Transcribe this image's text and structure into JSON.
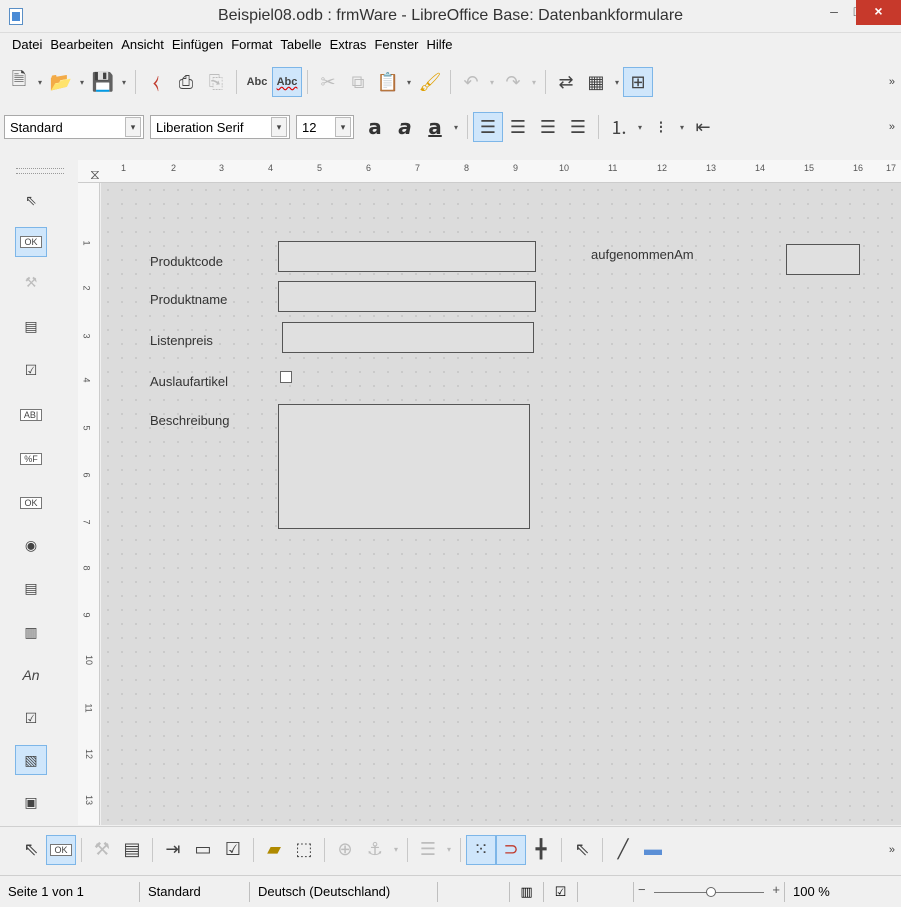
{
  "window": {
    "title": "Beispiel08.odb : frmWare - LibreOffice Base: Datenbankformulare",
    "minimize": "–",
    "maximize": "□",
    "close": "×"
  },
  "menu": [
    {
      "label": "Datei"
    },
    {
      "label": "Bearbeiten"
    },
    {
      "label": "Ansicht"
    },
    {
      "label": "Einfügen"
    },
    {
      "label": "Format"
    },
    {
      "label": "Tabelle"
    },
    {
      "label": "Extras"
    },
    {
      "label": "Fenster"
    },
    {
      "label": "Hilfe"
    }
  ],
  "toolbar1": {
    "icons": [
      "new-document-icon",
      "open-folder-icon",
      "save-icon",
      "export-pdf-icon",
      "print-icon",
      "print-preview-icon",
      "spellcheck-icon",
      "autospellcheck-icon",
      "cut-icon",
      "copy-icon",
      "paste-icon",
      "clone-formatting-icon",
      "undo-icon",
      "redo-icon",
      "find-replace-icon",
      "table-icon",
      "design-mode-icon"
    ],
    "spell_label": "Abc",
    "more": "»"
  },
  "format_toolbar": {
    "paragraph_style": "Standard",
    "font_name": "Liberation Serif",
    "font_size": "12",
    "bold_glyph": "a",
    "italic_glyph": "a",
    "underline_glyph": "a",
    "more": "»"
  },
  "ruler": {
    "numbers": [
      "1",
      "2",
      "3",
      "4",
      "5",
      "6",
      "7",
      "8",
      "9",
      "10",
      "11",
      "12",
      "13",
      "14",
      "15",
      "16",
      "17"
    ],
    "vnumbers": [
      "1",
      "2",
      "3",
      "4",
      "5",
      "6",
      "7",
      "8",
      "9",
      "10",
      "11",
      "12",
      "13"
    ]
  },
  "left_toolbar": {
    "icons": [
      "select-icon",
      "design-mode-icon",
      "control-properties-icon",
      "form-properties-icon",
      "checkbox-icon",
      "textbox-icon",
      "formatted-field-icon",
      "push-button-icon",
      "option-button-icon",
      "list-box-icon",
      "combo-box-icon",
      "label-field-icon",
      "more-controls-icon",
      "form-design-icon",
      "form-navigator-icon"
    ],
    "textbox_label": "AB|",
    "formatted_label": "%F",
    "ok_label": "OK",
    "label_text": "An"
  },
  "form": {
    "labels": {
      "produktcode": "Produktcode",
      "produktname": "Produktname",
      "listenpreis": "Listenpreis",
      "auslaufartikel": "Auslaufartikel",
      "beschreibung": "Beschreibung",
      "aufgenommenam": "aufgenommenAm"
    }
  },
  "bottom_toolbar": {
    "icons": [
      "select-icon",
      "design-mode-icon",
      "control-wizard-icon",
      "form-properties-icon",
      "tab-order-icon",
      "add-field-icon",
      "activation-order-icon",
      "form-navigator-icon",
      "group-icon",
      "anchor-icon",
      "align-icon",
      "grid-icon",
      "snap-to-grid-icon",
      "helplines-icon",
      "pointer-icon",
      "line-icon",
      "rectangle-icon"
    ],
    "more": "»"
  },
  "status": {
    "page": "Seite 1 von 1",
    "style": "Standard",
    "language": "Deutsch (Deutschland)",
    "zoom_minus": "−",
    "zoom_plus": "+",
    "zoom": "100 %"
  }
}
